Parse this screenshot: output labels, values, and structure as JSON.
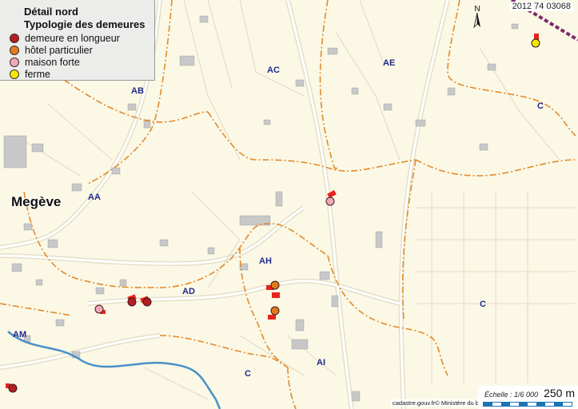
{
  "legend": {
    "title": "Détail nord",
    "subtitle": "Typologie des demeures",
    "items": [
      {
        "label": "demeure en longueur",
        "color": "#b51f24"
      },
      {
        "label": "hôtel particulier",
        "color": "#e37a1c"
      },
      {
        "label": "maison forte",
        "color": "#f2a8b4"
      },
      {
        "label": "ferme",
        "color": "#f6e500"
      }
    ]
  },
  "reference": "2012 74 03068",
  "town": "Megève",
  "zones": [
    "AB",
    "AC",
    "AE",
    "C",
    "AA",
    "AD",
    "AH",
    "AM",
    "C",
    "AI",
    "C"
  ],
  "credit": "cadastre.gouv.fr© Ministère du budget",
  "scale": {
    "label": "Échelle : 1/6 000",
    "distance": "250 m"
  },
  "colors": {
    "background": "#fbf8e6",
    "boundary": "#e38a2a",
    "building": "#c8c8c8",
    "river": "#4a90c8",
    "road": "#ffffff"
  },
  "icons": {
    "north": "north-arrow-icon"
  }
}
